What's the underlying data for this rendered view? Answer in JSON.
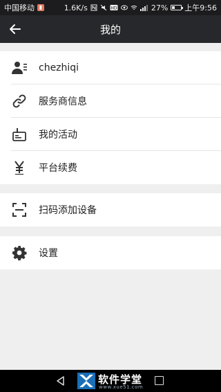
{
  "status_bar": {
    "carrier": "中国移动",
    "speed": "1.6K/s",
    "battery": "27%",
    "time": "上午9:56"
  },
  "header": {
    "title": "我的"
  },
  "groups": [
    {
      "items": [
        {
          "icon": "user-icon",
          "label": "chezhiqi"
        },
        {
          "icon": "link-icon",
          "label": "服务商信息"
        },
        {
          "icon": "badge-icon",
          "label": "我的活动"
        },
        {
          "icon": "yen-icon",
          "label": "平台续费"
        }
      ]
    },
    {
      "items": [
        {
          "icon": "scan-icon",
          "label": "扫码添加设备"
        }
      ]
    },
    {
      "items": [
        {
          "icon": "gear-icon",
          "label": "设置"
        }
      ]
    }
  ],
  "watermark": {
    "text": "软件学堂",
    "url": "www.xue51.com"
  },
  "colors": {
    "header_bg": "#27282b",
    "page_bg": "#efefef",
    "icon": "#333333"
  }
}
